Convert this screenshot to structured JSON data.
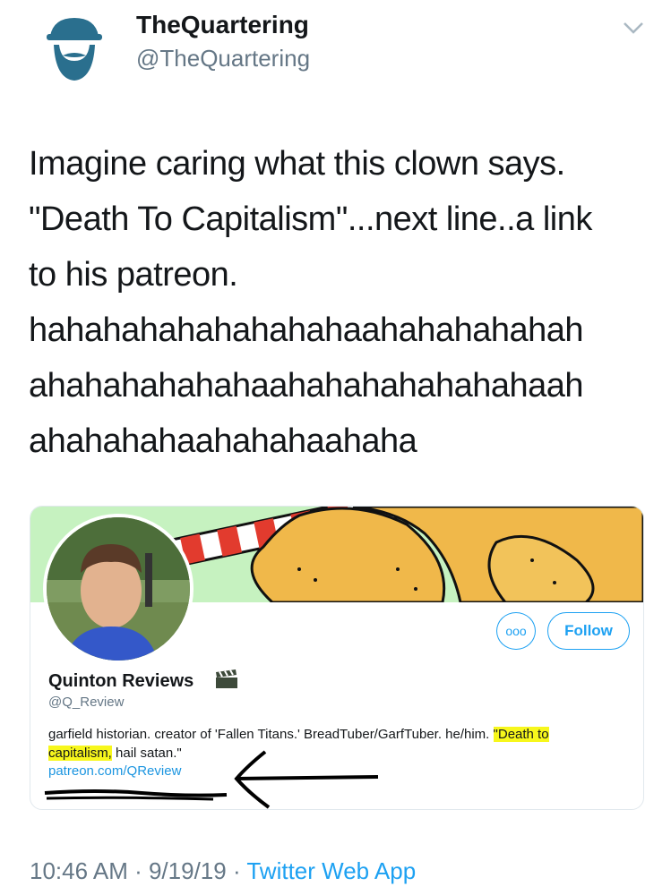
{
  "author": {
    "display_name": "TheQuartering",
    "handle": "@TheQuartering",
    "avatar_icon": "bearded-man-logo-icon"
  },
  "tweet": {
    "lines": [
      "Imagine caring what this clown says.",
      "\"Death To Capitalism\"...next line..a link",
      "to his patreon.",
      "hahahahahahahahahaahahahahahah",
      "ahahahahahahaahahahahahahahaah",
      "ahahahahaahahahaahaha"
    ]
  },
  "embedded_profile": {
    "name": "Quinton Reviews",
    "name_icon": "clapperboard-icon",
    "handle": "@Q_Review",
    "bio_part1": "garfield historian. creator of 'Fallen Titans.' BreadTuber/GarfTuber. he/him. ",
    "bio_highlight1": "\"Death to",
    "bio_highlight2": "capitalism,",
    "bio_part2": " hail satan.\"",
    "link": "patreon.com/QReview",
    "more_label": "ooo",
    "follow_label": "Follow"
  },
  "meta": {
    "time": "10:46 AM",
    "sep1": " · ",
    "date": "9/19/19",
    "sep2": " · ",
    "source": "Twitter Web App"
  },
  "colors": {
    "accent": "#1da1f2",
    "secondary_text": "#657786",
    "highlight": "#f7f71c"
  }
}
